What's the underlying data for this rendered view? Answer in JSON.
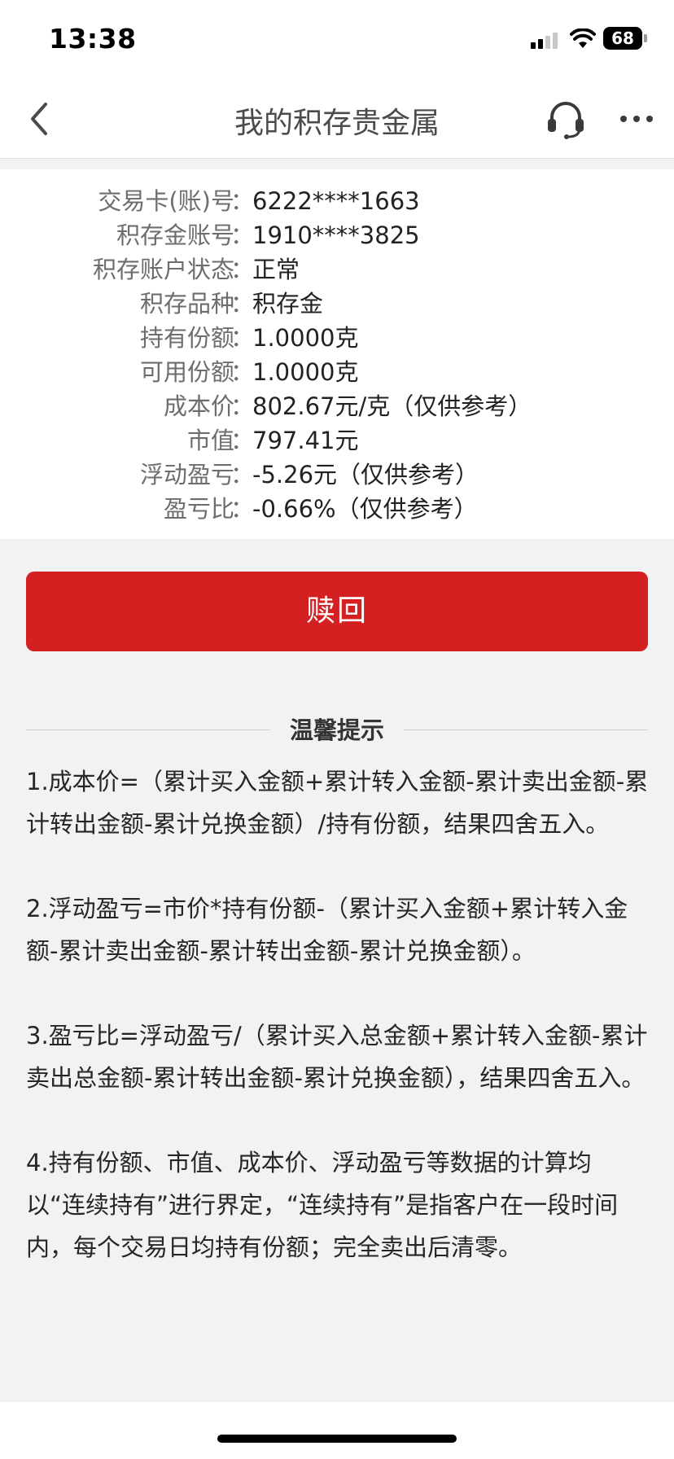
{
  "status_bar": {
    "time": "13:38",
    "battery": "68"
  },
  "nav": {
    "title": "我的积存贵金属"
  },
  "account_info": {
    "rows": [
      {
        "label": "交易卡(账)号",
        "value": "6222****1663"
      },
      {
        "label": "积存金账号",
        "value": "1910****3825"
      },
      {
        "label": "积存账户状态",
        "value": "正常"
      },
      {
        "label": "积存品种",
        "value": "积存金"
      },
      {
        "label": "持有份额",
        "value": "1.0000克"
      },
      {
        "label": "可用份额",
        "value": "1.0000克"
      },
      {
        "label": "成本价",
        "value": "802.67元/克（仅供参考）"
      },
      {
        "label": "市值",
        "value": "797.41元"
      },
      {
        "label": "浮动盈亏",
        "value": "-5.26元（仅供参考）"
      },
      {
        "label": "盈亏比",
        "value": "-0.66%（仅供参考）"
      }
    ],
    "colon": "："
  },
  "actions": {
    "redeem_label": "赎回"
  },
  "tips": {
    "title": "温馨提示",
    "items": [
      "1.成本价=（累计买入金额+累计转入金额-累计卖出金额-累计转出金额-累计兑换金额）/持有份额，结果四舍五入。",
      "2.浮动盈亏=市价*持有份额-（累计买入金额+累计转入金额-累计卖出金额-累计转出金额-累计兑换金额）。",
      "3.盈亏比=浮动盈亏/（累计买入总金额+累计转入金额-累计卖出总金额-累计转出金额-累计兑换金额），结果四舍五入。",
      "4.持有份额、市值、成本价、浮动盈亏等数据的计算均以“连续持有”进行界定，“连续持有”是指客户在一段时间内，每个交易日均持有份额；完全卖出后清零。"
    ]
  },
  "colors": {
    "accent_red": "#d42020",
    "background": "#f2f2f2",
    "card": "#ffffff"
  },
  "icons": {
    "back": "chevron-left-icon",
    "service": "headset-icon",
    "more": "more-horizontal-icon"
  }
}
